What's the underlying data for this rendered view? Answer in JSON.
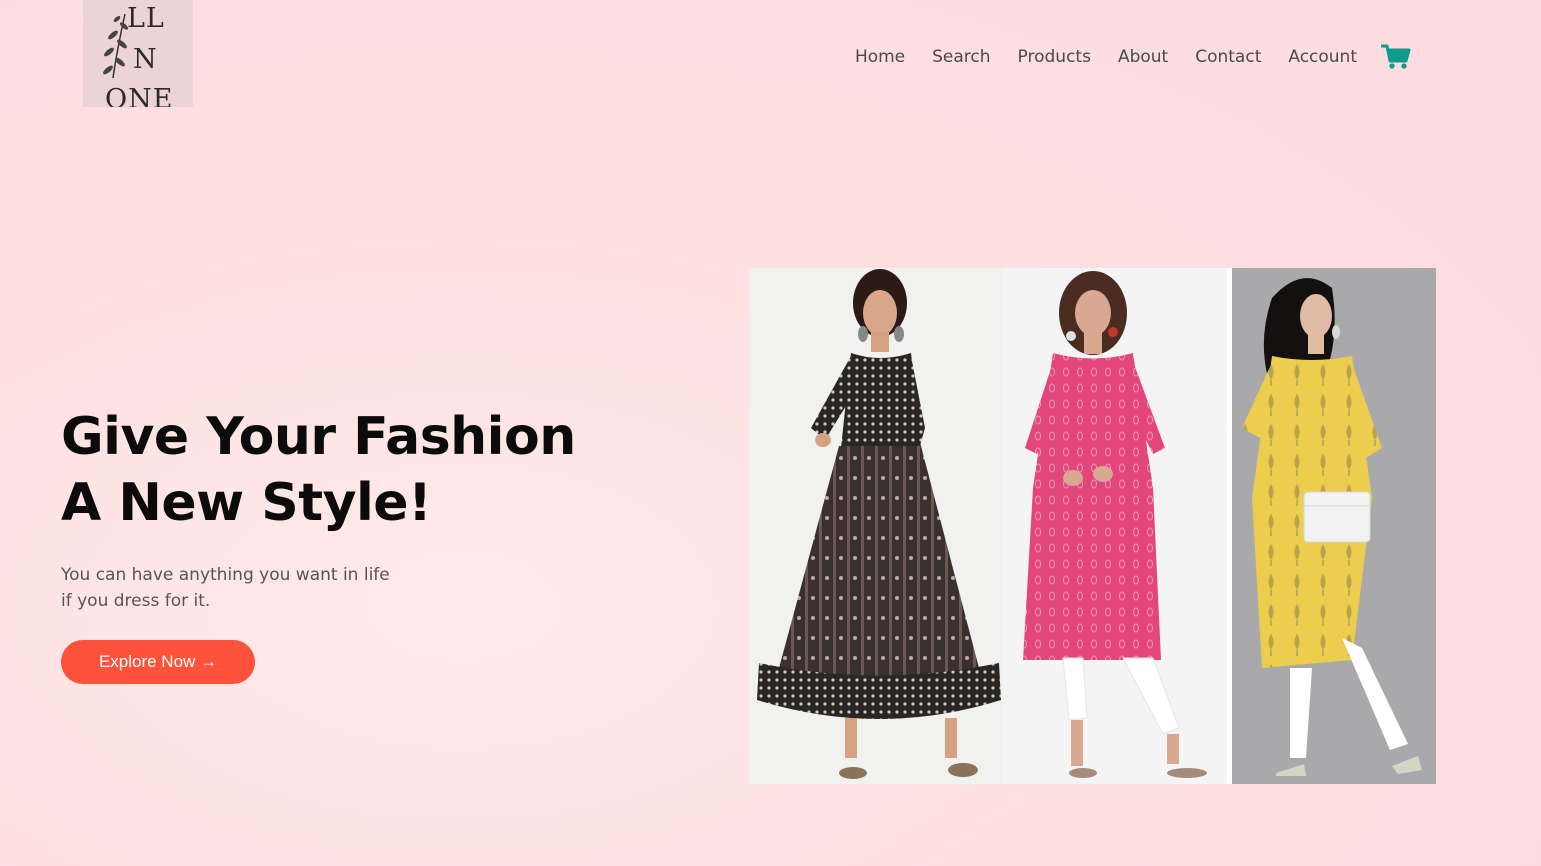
{
  "brand": {
    "logo_lines": [
      "LL",
      "N",
      "ONE"
    ]
  },
  "nav": {
    "items": [
      "Home",
      "Search",
      "Products",
      "About",
      "Contact",
      "Account"
    ],
    "cart_icon": "cart-icon"
  },
  "hero": {
    "title_line1": "Give Your Fashion",
    "title_line2": "A New Style!",
    "subtitle_line1": "You can have anything you want in life",
    "subtitle_line2": "if you dress for it.",
    "cta_label": "Explore Now →"
  },
  "colors": {
    "accent": "#ff523b",
    "cart": "#0e9a8d",
    "background": "#ffe0e1"
  }
}
